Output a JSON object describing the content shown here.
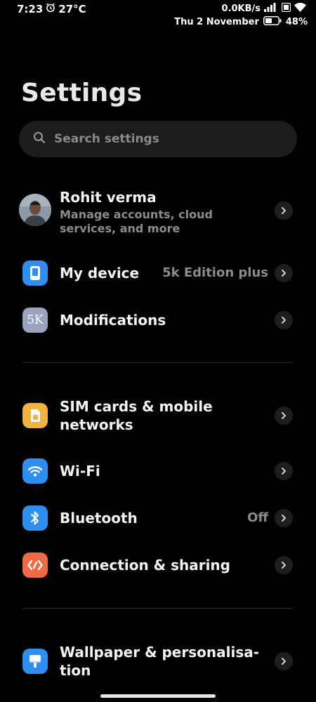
{
  "status_bar": {
    "time": "7:23",
    "temperature": "27°C",
    "net_speed": "0.0KB/s",
    "date": "Thu 2 November",
    "battery": "48%"
  },
  "page": {
    "title": "Settings"
  },
  "search": {
    "placeholder": "Search settings"
  },
  "account": {
    "name": "Rohit verma",
    "subtitle_line1": "Manage accounts, cloud",
    "subtitle_line2": "services, and more"
  },
  "items": {
    "my_device": {
      "label": "My device",
      "value": "5k Edition plus"
    },
    "modifications": {
      "label": "Modifications",
      "icon_text": "5K"
    },
    "sim": {
      "label_line1": "SIM cards & mobile",
      "label_line2": "networks"
    },
    "wifi": {
      "label": "Wi-Fi"
    },
    "bluetooth": {
      "label": "Bluetooth",
      "value": "Off"
    },
    "connection": {
      "label": "Connection & sharing"
    },
    "wallpaper": {
      "label_line1": "Wallpaper & personalisa-",
      "label_line2": "tion"
    }
  },
  "colors": {
    "blue_icon": "#2f8ff0",
    "sim_icon": "#f1b33f",
    "connection_icon": "#ef6a45",
    "modifications_icon": "#9aa3bd"
  }
}
